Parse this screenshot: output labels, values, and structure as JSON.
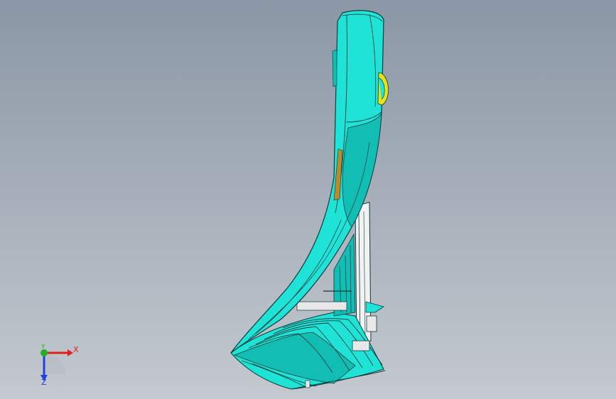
{
  "viewport": {
    "background_top": "#8b97a6",
    "background_bottom": "#c4c9cf"
  },
  "model": {
    "fill_color": "#1fe3d6",
    "shade_color": "#12bdb3",
    "edge_color": "#0b3b3a",
    "detail_color": "#e8e8e8",
    "accent_color": "#e6e21b"
  },
  "triad": {
    "x_label": "X",
    "y_label": "Y",
    "z_label": "Z",
    "x_color": "#e02020",
    "y_color": "#20b020",
    "z_color": "#2040e0"
  }
}
